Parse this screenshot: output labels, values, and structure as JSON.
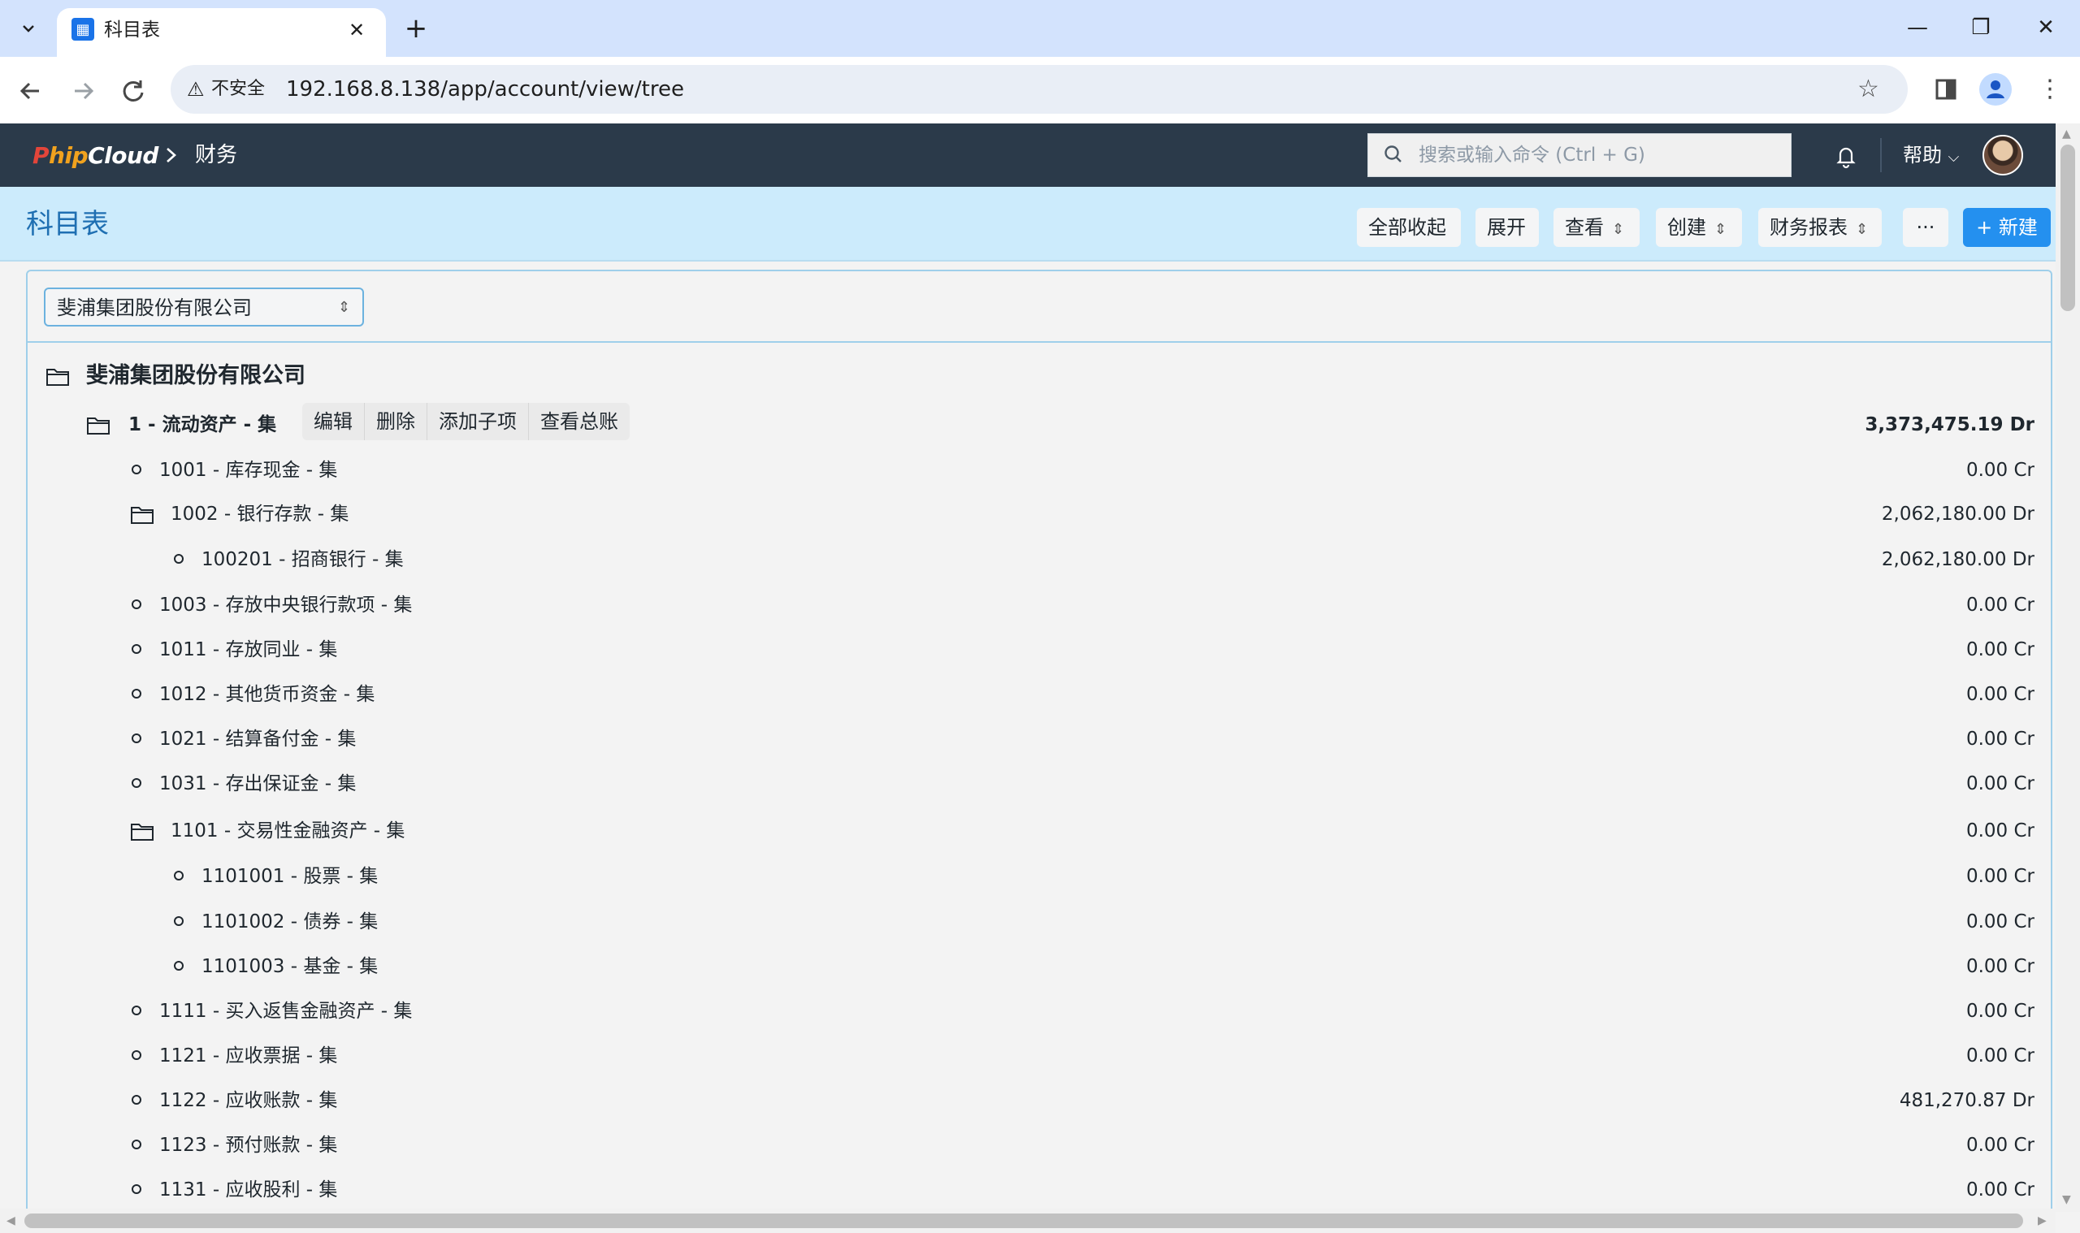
{
  "browser": {
    "tab_title": "科目表",
    "security_label": "不安全",
    "url": "192.168.8.138/app/account/view/tree"
  },
  "navbar": {
    "logo_p": "P",
    "logo_hip": "hip",
    "logo_cloud": "Cloud",
    "breadcrumb": "财务",
    "search_placeholder": "搜索或输入命令 (Ctrl + G)",
    "help_label": "帮助"
  },
  "header": {
    "title": "科目表",
    "collapse_all_label": "全部收起",
    "expand_label": "展开",
    "view_label": "查看",
    "create_label": "创建",
    "financial_reports_label": "财务报表",
    "more_label": "···",
    "new_label": "+ 新建"
  },
  "filter": {
    "company": "斐浦集团股份有限公司"
  },
  "tree": {
    "root_label": "斐浦集团股份有限公司",
    "row_actions": {
      "edit": "编辑",
      "delete": "删除",
      "add_child": "添加子项",
      "view_ledger": "查看总账"
    },
    "rows": [
      {
        "label": "1 - 流动资产 - 集",
        "amount": "3,373,475.19 Dr"
      },
      {
        "label": "1001 - 库存现金 - 集",
        "amount": "0.00 Cr"
      },
      {
        "label": "1002 - 银行存款 - 集",
        "amount": "2,062,180.00 Dr"
      },
      {
        "label": "100201 - 招商银行 - 集",
        "amount": "2,062,180.00 Dr"
      },
      {
        "label": "1003 - 存放中央银行款项 - 集",
        "amount": "0.00 Cr"
      },
      {
        "label": "1011 - 存放同业 - 集",
        "amount": "0.00 Cr"
      },
      {
        "label": "1012 - 其他货币资金 - 集",
        "amount": "0.00 Cr"
      },
      {
        "label": "1021 - 结算备付金 - 集",
        "amount": "0.00 Cr"
      },
      {
        "label": "1031 - 存出保证金 - 集",
        "amount": "0.00 Cr"
      },
      {
        "label": "1101 - 交易性金融资产 - 集",
        "amount": "0.00 Cr"
      },
      {
        "label": "1101001 - 股票 - 集",
        "amount": "0.00 Cr"
      },
      {
        "label": "1101002 - 债券 - 集",
        "amount": "0.00 Cr"
      },
      {
        "label": "1101003 - 基金 - 集",
        "amount": "0.00 Cr"
      },
      {
        "label": "1111 - 买入返售金融资产 - 集",
        "amount": "0.00 Cr"
      },
      {
        "label": "1121 - 应收票据 - 集",
        "amount": "0.00 Cr"
      },
      {
        "label": "1122 - 应收账款 - 集",
        "amount": "481,270.87 Dr"
      },
      {
        "label": "1123 - 预付账款 - 集",
        "amount": "0.00 Cr"
      },
      {
        "label": "1131 - 应收股利 - 集",
        "amount": "0.00 Cr"
      }
    ]
  },
  "colors": {
    "navbar_bg": "#2b3a4a",
    "header_bg": "#ccebfc",
    "primary": "#2490ef",
    "title_blue": "#1f6fb2"
  }
}
